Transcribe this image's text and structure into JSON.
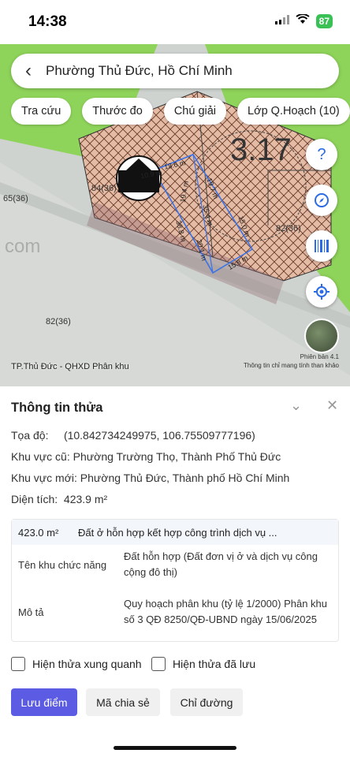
{
  "status": {
    "time": "14:38",
    "battery": "87"
  },
  "search": {
    "title": "Phường Thủ Đức, Hồ Chí Minh"
  },
  "chips": [
    "Tra cứu",
    "Thước đo",
    "Chú giải",
    "Lớp Q.Hoạch (10)"
  ],
  "map": {
    "parcel_label": "3.17",
    "parcel_code": "84(36)",
    "lot_codes": [
      "65(36)",
      "82(36)",
      "82(36)",
      "61(36)"
    ],
    "watermark": "com",
    "measures": [
      "10.9 m",
      "13.6 m",
      "19.4 m",
      "19.7 m",
      "35.4 m",
      "20.1 m",
      "38.8 m",
      "15.0 m",
      "15.8 m"
    ],
    "caption": "TP.Thủ Đức - QHXD Phân khu",
    "credit": "Thông tin chỉ mang tính than khảo",
    "version": "Phiên bản 4.1",
    "fabs": [
      "help-icon",
      "compass-icon",
      "barcode-icon",
      "locate-icon"
    ]
  },
  "panel": {
    "title": "Thông tin thửa",
    "coord_label": "Tọa độ:",
    "coord_value": "(10.842734249975, 106.75509777196)",
    "old_area_label": "Khu vực cũ:",
    "old_area_value": "Phường Trường Thọ, Thành Phố Thủ Đức",
    "new_area_label": "Khu vực mới:",
    "new_area_value": "Phường Thủ Đức, Thành phố Hồ Chí Minh",
    "size_label": "Diện tích:",
    "size_value": "423.9 m²",
    "card": {
      "area": "423.0 m²",
      "usage": "Đất ở hỗn hợp kết hợp công trình dịch vụ ...",
      "func_label": "Tên khu chức năng",
      "func_value": "Đất hỗn hợp (Đất đơn vị ở và dịch vụ công cộng đô thị)",
      "desc_label": "Mô tả",
      "desc_value": "Quy hoạch phân khu (tỷ lệ 1/2000) Phân khu số 3 QĐ 8250/QĐ-UBND ngày 15/06/2025"
    },
    "check_nearby": "Hiện thửa xung quanh",
    "check_saved": "Hiện thửa đã lưu",
    "btn_save": "Lưu điểm",
    "btn_share": "Mã chia sẻ",
    "btn_route": "Chỉ đường"
  },
  "colors": {
    "accent": "#5b5be3",
    "green": "#8ed35a",
    "parcel": "#e3b9a6",
    "measure": "#3a73e8"
  }
}
